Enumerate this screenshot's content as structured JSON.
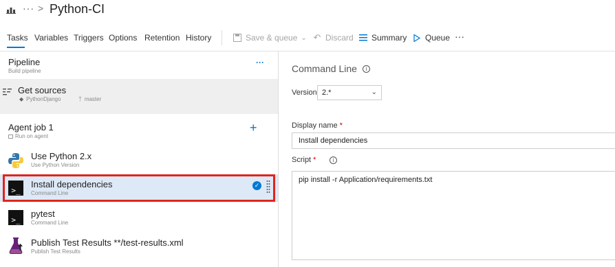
{
  "header": {
    "title": "Python-CI",
    "more": "···",
    "separator": ">"
  },
  "tabs": [
    "Tasks",
    "Variables",
    "Triggers",
    "Options",
    "Retention",
    "History"
  ],
  "toolbar": {
    "save_queue": "Save & queue",
    "discard": "Discard",
    "summary": "Summary",
    "queue": "Queue",
    "more": "···"
  },
  "pipeline": {
    "title": "Pipeline",
    "subtitle": "Build pipeline",
    "more": "···"
  },
  "get_sources": {
    "title": "Get sources",
    "repo": "PythonDjango",
    "branch": "master"
  },
  "agent_job": {
    "title": "Agent job 1",
    "subtitle": "Run on agent",
    "add": "+"
  },
  "tasks": [
    {
      "title": "Use Python 2.x",
      "subtitle": "Use Python Version",
      "icon": "python-icon"
    },
    {
      "title": "Install dependencies",
      "subtitle": "Command Line",
      "icon": "terminal-icon"
    },
    {
      "title": "pytest",
      "subtitle": "Command Line",
      "icon": "terminal-icon"
    },
    {
      "title": "Publish Test Results **/test-results.xml",
      "subtitle": "Publish Test Results",
      "icon": "flask-icon"
    }
  ],
  "details": {
    "title": "Command Line",
    "version_label": "Version",
    "version_value": "2.*",
    "display_name_label": "Display name",
    "display_name_value": "Install dependencies",
    "script_label": "Script",
    "script_value": "pip install -r Application/requirements.txt",
    "required_mark": "*"
  },
  "colors": {
    "accent": "#0078d4",
    "selected_row": "#dde9f6",
    "highlight_border": "#e0241c"
  }
}
